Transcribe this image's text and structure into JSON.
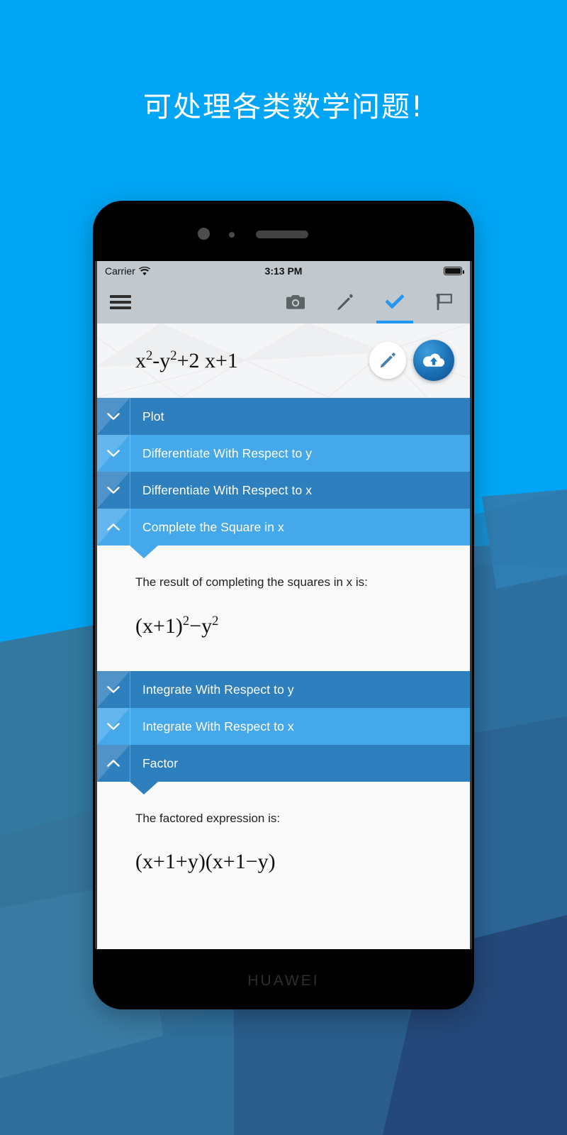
{
  "page": {
    "headline": "可处理各类数学问题!",
    "bg_color": "#00A6F5",
    "accent_color": "#2196f3"
  },
  "device": {
    "brand": "HUAWEI"
  },
  "status_bar": {
    "carrier": "Carrier",
    "wifi_icon": "wifi-icon",
    "time": "3:13 PM",
    "battery_icon": "battery-full-icon"
  },
  "toolbar": {
    "menu_icon": "hamburger-menu-icon",
    "tabs": [
      {
        "icon": "camera-icon",
        "active": false
      },
      {
        "icon": "pencil-icon",
        "active": false
      },
      {
        "icon": "check-icon",
        "active": true
      },
      {
        "icon": "flag-icon",
        "active": false
      }
    ]
  },
  "expression_bar": {
    "expression_plain": "x²-y²+2x+1",
    "expression_base1": "x",
    "expression_sup1": "2",
    "expression_mid1": "-y",
    "expression_sup2": "2",
    "expression_tail": "+2 x+1",
    "edit_button_icon": "pencil-icon",
    "upload_button_icon": "cloud-upload-icon"
  },
  "results": {
    "rows": [
      {
        "label": "Plot",
        "expanded": false,
        "tone": "dark",
        "chevron": "chevron-down-icon"
      },
      {
        "label": "Differentiate With Respect to y",
        "expanded": false,
        "tone": "light",
        "chevron": "chevron-down-icon"
      },
      {
        "label": "Differentiate With Respect to x",
        "expanded": false,
        "tone": "dark",
        "chevron": "chevron-down-icon"
      },
      {
        "label": "Complete the Square in x",
        "expanded": true,
        "tone": "light",
        "chevron": "chevron-up-icon",
        "body_text": "The result of completing the squares in x is:",
        "math_a": "(x+1)",
        "math_sup_a": "2",
        "math_b": "−y",
        "math_sup_b": "2"
      },
      {
        "label": "Integrate With Respect to y",
        "expanded": false,
        "tone": "dark",
        "chevron": "chevron-down-icon"
      },
      {
        "label": "Integrate With Respect to x",
        "expanded": false,
        "tone": "light",
        "chevron": "chevron-down-icon"
      },
      {
        "label": "Factor",
        "expanded": true,
        "tone": "dark",
        "chevron": "chevron-up-icon",
        "body_text": "The factored expression is:",
        "math_full": "(x+1+y)(x+1−y)"
      }
    ]
  },
  "colors": {
    "row_dark": "#2e7fbe",
    "row_light": "#45a8ea",
    "status_bar": "#c2c9ce",
    "panel_bg": "#fafafa"
  }
}
